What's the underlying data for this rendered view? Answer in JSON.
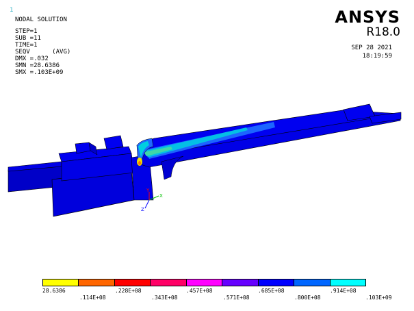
{
  "window_number": "1",
  "info": {
    "title": "NODAL SOLUTION",
    "lines": [
      "STEP=1",
      "SUB =11",
      "TIME=1",
      "SEQV      (AVG)",
      "DMX =.032",
      "SMN =28.6386",
      "SMX =.103E+09"
    ]
  },
  "brand": {
    "name": "ANSYS",
    "release": "R18.0"
  },
  "date": "SEP 28 2021",
  "time": "18:19:59",
  "triad": {
    "x_label": "X",
    "y_label": "Y",
    "z_label": "Z"
  },
  "legend": {
    "colors": [
      "#ffff00",
      "#ff6600",
      "#ff0000",
      "#ff0066",
      "#ff00ff",
      "#6600ff",
      "#0000ff",
      "#0066ff",
      "#00ffff"
    ],
    "top_labels": [
      "28.6386",
      ".228E+08",
      ".457E+08",
      ".685E+08",
      ".914E+08"
    ],
    "bottom_labels": [
      ".114E+08",
      ".343E+08",
      ".571E+08",
      ".800E+08",
      ".103E+09"
    ]
  },
  "model_colors": {
    "base_dark": "#0000b4",
    "base": "#0000e6",
    "light_blue": "#1e6aff",
    "cyan": "#00cfe0",
    "green": "#3fd7a8",
    "yellow": "#f0e000",
    "orange": "#ff7a00"
  }
}
